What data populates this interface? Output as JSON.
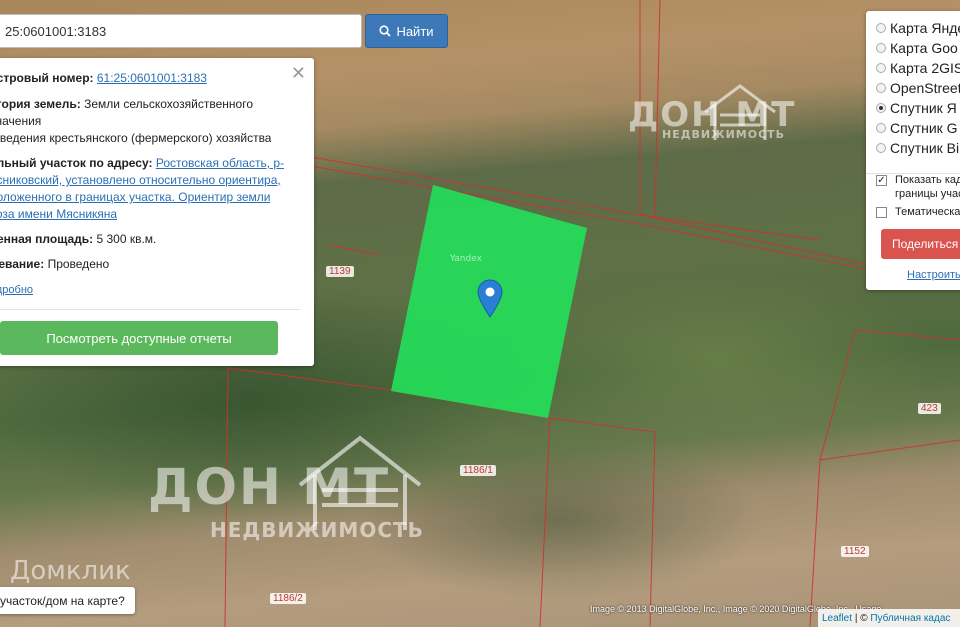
{
  "search": {
    "value": "25:0601001:3183",
    "button_label": "Найти"
  },
  "info": {
    "cadastral_label": "астровый номер:",
    "cadastral_value": "61:25:0601001:3183",
    "category_label": "егория земель:",
    "category_value_1": "Земли сельскохозяйственного",
    "category_value_2": "значения",
    "usage_value": "я ведения крестьянского (фермерского) хозяйства",
    "address_label": "ельный участок по адресу:",
    "address_line_1": "Ростовская область, р-",
    "address_line_2": "ясниковский, установлено относительно ориентира,",
    "address_line_3": "положенного в границах участка. Ориентир земли",
    "address_line_4": "хоза имени Мясникяна",
    "area_label": "ченная площадь:",
    "area_value": "5 300 кв.м.",
    "survey_label": "жевание:",
    "survey_value": "Проведено",
    "details_link": "одробно",
    "reports_button": "Посмотреть доступные отчеты"
  },
  "layers": {
    "options": [
      {
        "label": "Карта Янде",
        "selected": false
      },
      {
        "label": "Карта Goo",
        "selected": false
      },
      {
        "label": "Карта 2GIS",
        "selected": false
      },
      {
        "label": "OpenStreet",
        "selected": false
      },
      {
        "label": "Спутник Я",
        "selected": true
      },
      {
        "label": "Спутник G",
        "selected": false
      },
      {
        "label": "Спутник Bi",
        "selected": false
      }
    ],
    "show_cadastral_1": "Показать када",
    "show_cadastral_2": "границы учас",
    "show_cadastral_checked": true,
    "thematic": "Тематическа",
    "thematic_checked": false,
    "share_button": "Поделиться",
    "settings_link": "Настроить"
  },
  "map": {
    "watermark_main": "ДОН  МТ",
    "watermark_sub": "НЕДВИЖИМОСТЬ",
    "watermark_domclick": "Домклик",
    "yandex_label": "Yandex",
    "parcel_labels": [
      "1139",
      "1186/1",
      "423",
      "1152",
      "1186/2"
    ],
    "plot_color": "#22e05a",
    "marker_color": "#2a7fd4"
  },
  "bottom": {
    "where_text": "участок/дом на карте?",
    "attribution": "Image © 2013 DigitalGlobe, Inc., Image © 2020 DigitalGlobe, Inc., Usage",
    "leaflet": "Leaflet",
    "separator": "| ©",
    "pkk": "Публичная кадас"
  }
}
